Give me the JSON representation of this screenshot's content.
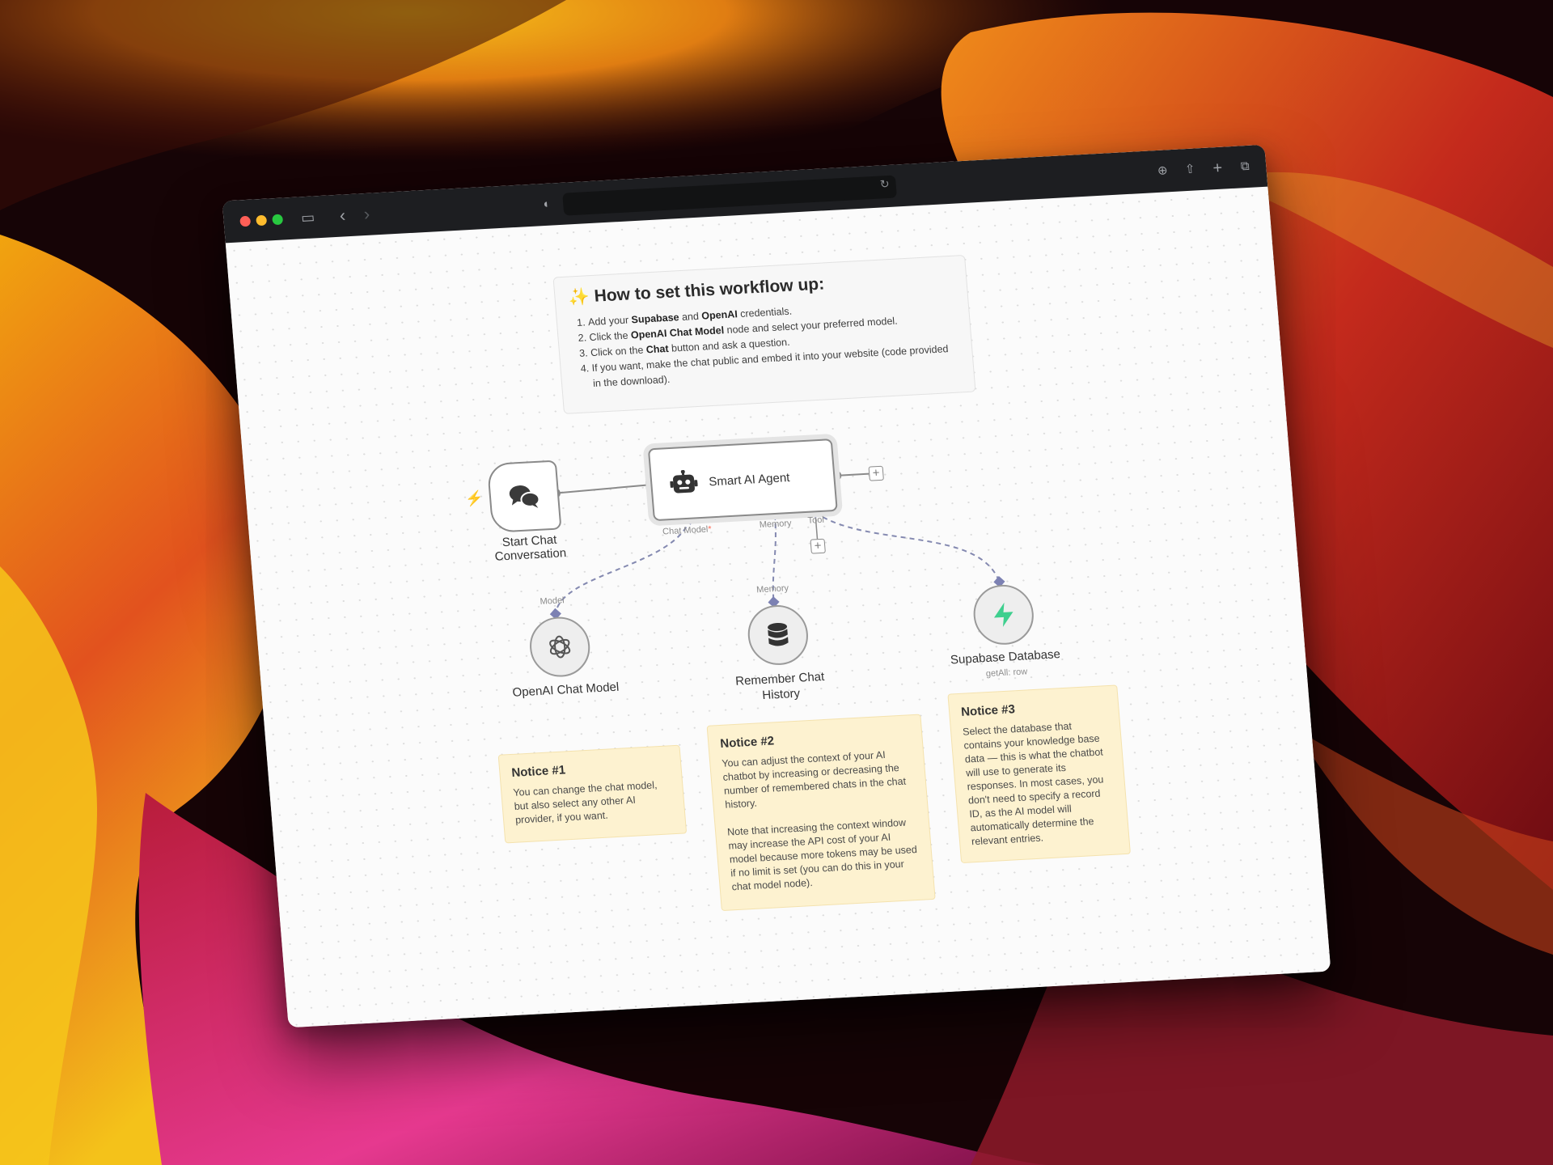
{
  "wallpaper": {
    "description_colors": [
      "#120406",
      "#f5a20f",
      "#e8402a",
      "#9b1240",
      "#e6398f"
    ]
  },
  "browser": {
    "toolbar_icons": [
      "sidebar-icon",
      "back-icon",
      "forward-icon",
      "shield-icon",
      "reload-icon",
      "download-icon",
      "share-icon",
      "new-tab-icon",
      "tabs-overview-icon"
    ]
  },
  "instructions": {
    "title": "How to set this workflow up:",
    "steps": [
      {
        "pre": "Add your ",
        "b1": "Supabase",
        "mid": " and ",
        "b2": "OpenAI",
        "post": " credentials."
      },
      {
        "pre": "Click the ",
        "b1": "OpenAI Chat Model",
        "post": " node and select your preferred model."
      },
      {
        "pre": "Click on the ",
        "b1": "Chat",
        "post": " button and ask a question."
      },
      {
        "pre": "If you want, make the chat public and embed it into your website (code provided in the download)."
      }
    ]
  },
  "nodes": {
    "trigger": {
      "label": "Start Chat Conversation"
    },
    "agent": {
      "label": "Smart AI Agent",
      "ports": {
        "chat_model": "Chat Model",
        "chat_model_required": "*",
        "memory": "Memory",
        "tool": "Tool"
      }
    },
    "openai": {
      "label": "OpenAI Chat Model",
      "port": "Model"
    },
    "memory": {
      "label_line1": "Remember Chat",
      "label_line2": "History",
      "port": "Memory"
    },
    "supabase": {
      "label": "Supabase Database",
      "sub": "getAll: row"
    }
  },
  "notes": [
    {
      "title": "Notice #1",
      "body": "You can change the chat model, but also select any other AI provider, if you want."
    },
    {
      "title": "Notice #2",
      "body": "You can adjust the context of your AI chatbot by increasing or decreasing the number of remembered chats in the chat history.\n\nNote that increasing the context window may increase the API cost of your AI model because more tokens may be used if no limit is set (you can do this in your chat model node)."
    },
    {
      "title": "Notice #3",
      "body": "Select the database that contains your knowledge base data — this is what the chatbot will use to generate its responses. In most cases, you don't need to specify a record ID, as the AI model will automatically determine the relevant entries."
    }
  ]
}
